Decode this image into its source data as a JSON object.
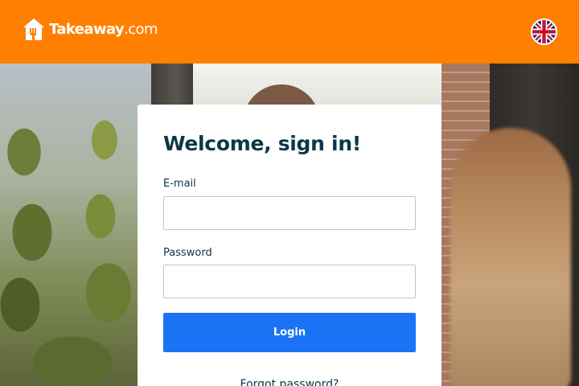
{
  "header": {
    "logo": {
      "brand": "Takeaway",
      "suffix": ".com",
      "icon": "house-fork-icon"
    },
    "language": {
      "icon": "uk-flag-icon"
    },
    "background_color": "#ff8000"
  },
  "login": {
    "title": "Welcome, sign in!",
    "email_label": "E-mail",
    "email_value": "",
    "password_label": "Password",
    "password_value": "",
    "login_button": "Login",
    "forgot_password": "Forgot password?"
  },
  "colors": {
    "accent": "#ff8000",
    "button": "#1a73f5",
    "text": "#0a3847"
  }
}
